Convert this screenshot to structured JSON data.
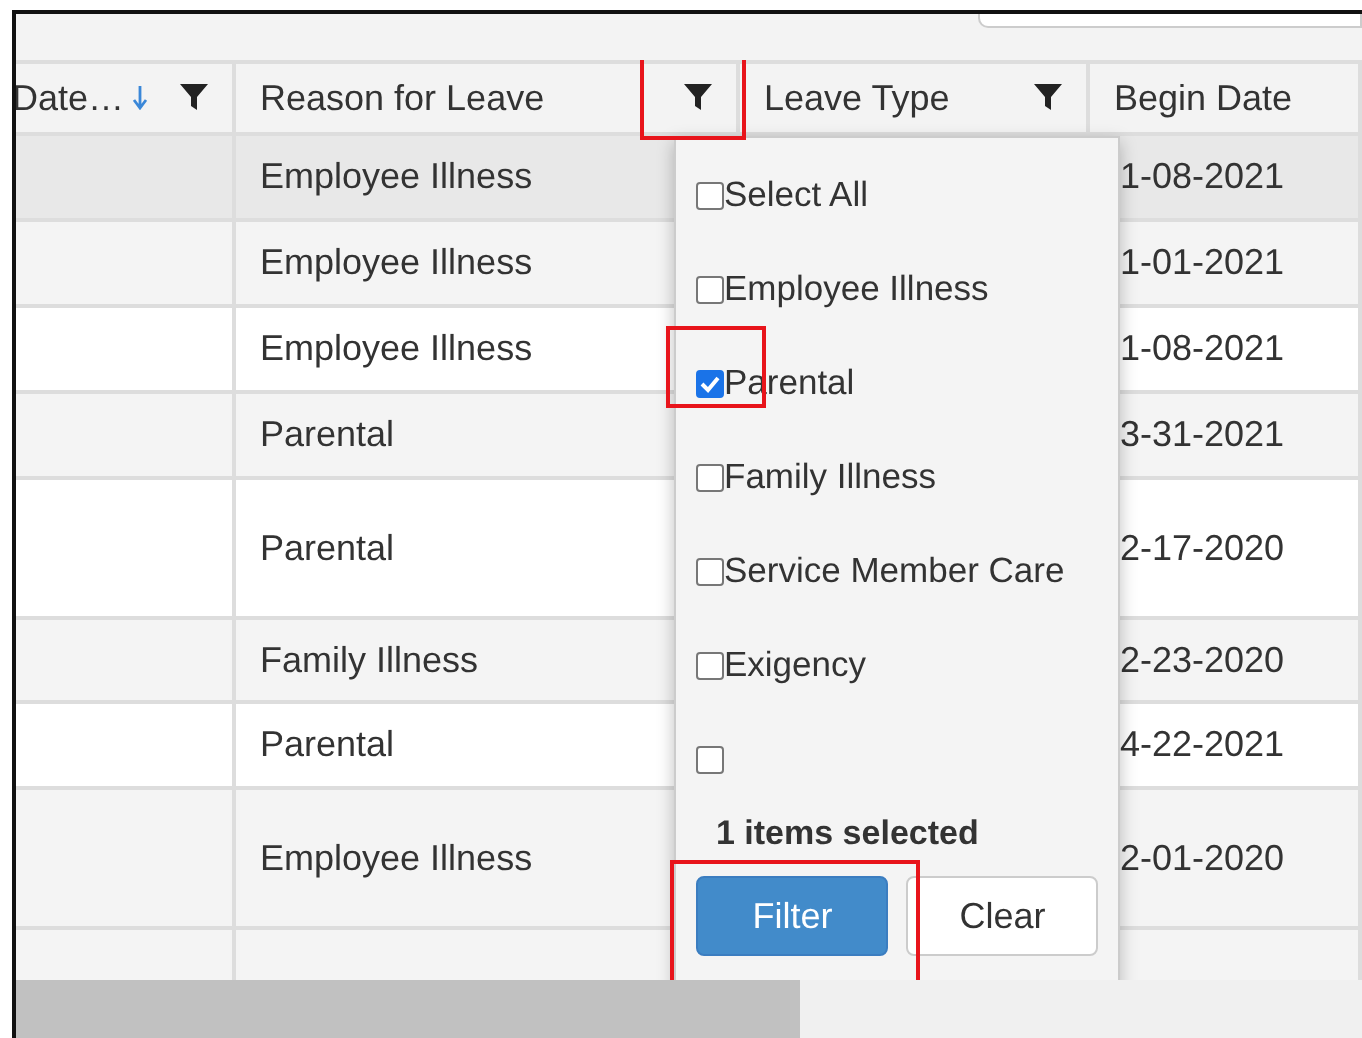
{
  "columns": [
    {
      "label": "Date…",
      "sorted": true,
      "filter": true
    },
    {
      "label": "Reason for Leave",
      "sorted": false,
      "filter": true
    },
    {
      "label": "Leave Type",
      "sorted": false,
      "filter": true
    },
    {
      "label": "Begin Date",
      "sorted": false,
      "filter": false
    }
  ],
  "rows": [
    {
      "reason": "Employee Illness",
      "begin_date": "1-08-2021",
      "highlighted": true
    },
    {
      "reason": "Employee Illness",
      "begin_date": "1-01-2021",
      "highlighted": false
    },
    {
      "reason": "Employee Illness",
      "begin_date": "1-08-2021",
      "highlighted": false
    },
    {
      "reason": "Parental",
      "begin_date": "3-31-2021",
      "highlighted": false
    },
    {
      "reason": "Parental",
      "begin_date": "2-17-2020",
      "highlighted": false
    },
    {
      "reason": "Family Illness",
      "begin_date": "2-23-2020",
      "highlighted": false
    },
    {
      "reason": "Parental",
      "begin_date": "4-22-2021",
      "highlighted": false
    },
    {
      "reason": "Employee Illness",
      "begin_date": "2-01-2020",
      "highlighted": false
    }
  ],
  "filter_popup": {
    "options": [
      {
        "label": "Select All",
        "checked": false
      },
      {
        "label": "Employee Illness",
        "checked": false
      },
      {
        "label": "Parental",
        "checked": true
      },
      {
        "label": "Family Illness",
        "checked": false
      },
      {
        "label": "Service Member Care",
        "checked": false
      },
      {
        "label": "Exigency",
        "checked": false
      },
      {
        "checked": false
      }
    ],
    "summary": "1 items selected",
    "buttons": [
      {
        "label": "Filter",
        "kind": "primary"
      },
      {
        "label": "Clear",
        "kind": "default"
      }
    ]
  }
}
